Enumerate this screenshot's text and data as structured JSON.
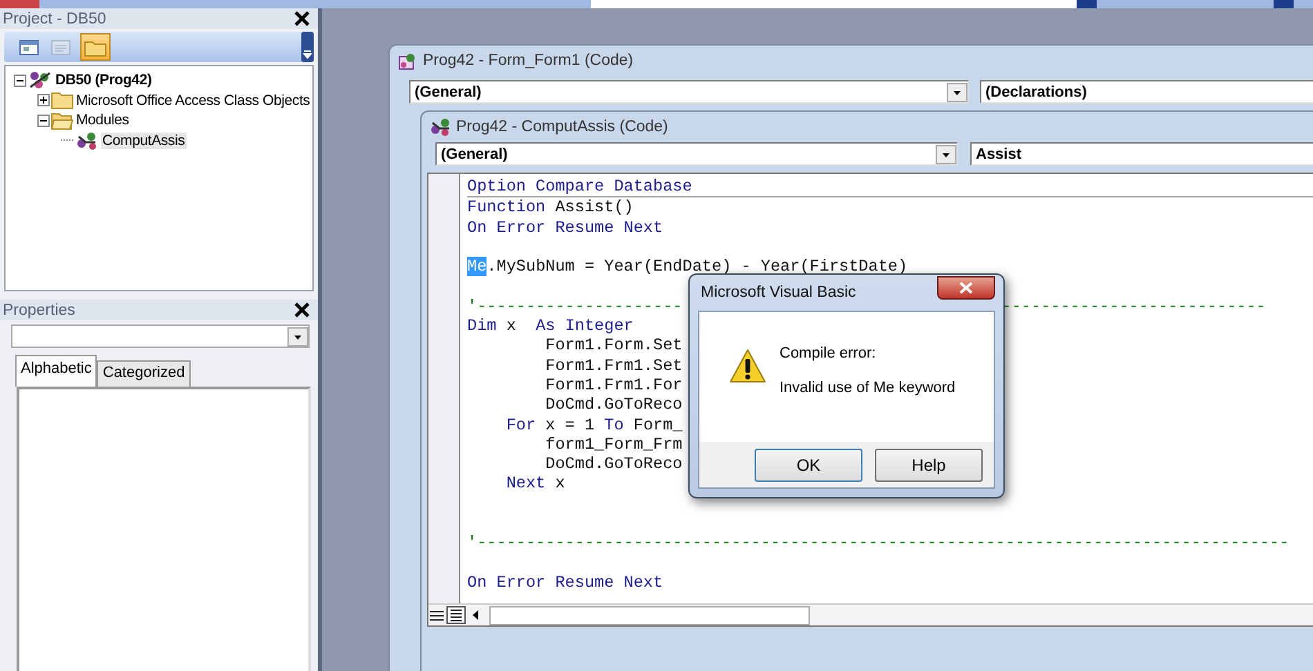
{
  "project_pane": {
    "title": "Project - DB50",
    "toolbar_buttons": [
      {
        "kind": "form",
        "selected": false,
        "disabled": false
      },
      {
        "kind": "list",
        "selected": false,
        "disabled": true
      },
      {
        "kind": "folder",
        "selected": true,
        "disabled": false
      }
    ],
    "tree": [
      {
        "label": "DB50 (Prog42)",
        "kind": "project",
        "expanded": true,
        "selected": false,
        "children": [
          {
            "label": "Microsoft Office Access Class Objects",
            "kind": "folder",
            "expanded": false,
            "selected": false
          },
          {
            "label": "Modules",
            "kind": "folder",
            "expanded": true,
            "selected": false,
            "children": [
              {
                "label": "ComputAssis",
                "kind": "module",
                "selected": true
              }
            ]
          }
        ]
      }
    ]
  },
  "properties_pane": {
    "title": "Properties",
    "tabs": [
      {
        "label": "Alphabetic",
        "selected": true
      },
      {
        "label": "Categorized",
        "selected": false
      }
    ]
  },
  "form_window": {
    "title": "Prog42 - Form_Form1 (Code)",
    "object_combo": "(General)",
    "procedure_combo": "(Declarations)"
  },
  "module_window": {
    "title": "Prog42 - ComputAssis (Code)",
    "object_combo": "(General)",
    "procedure_combo": "Assist",
    "code_lines": [
      {
        "separator": true,
        "segments": [
          {
            "text": "Option Compare Database",
            "kind": "keyword"
          }
        ]
      },
      {
        "segments": [
          {
            "text": "Function",
            "kind": "keyword"
          },
          {
            "text": " Assist()",
            "kind": "plain"
          }
        ]
      },
      {
        "segments": [
          {
            "text": "On Error Resume Next",
            "kind": "keyword"
          }
        ]
      },
      {
        "blank_before": true,
        "segments": [
          {
            "text": "Me",
            "kind": "selected"
          },
          {
            "text": ".MySubNum = Year(EndDate) - Year(FirstDate)",
            "kind": "plain"
          }
        ]
      },
      {
        "blank_before": true,
        "segments": [
          {
            "text": "'---------------------",
            "kind": "comment"
          }
        ],
        "tail": {
          "text": "---------------------------",
          "kind": "comment"
        }
      },
      {
        "segments": [
          {
            "text": "Dim",
            "kind": "keyword"
          },
          {
            "text": " x  ",
            "kind": "plain"
          },
          {
            "text": "As Integer",
            "kind": "keyword"
          }
        ]
      },
      {
        "segments": [
          {
            "text": "        Form1.Form.Set",
            "kind": "plain"
          }
        ]
      },
      {
        "segments": [
          {
            "text": "        Form1.Frm1.Set",
            "kind": "plain"
          }
        ]
      },
      {
        "segments": [
          {
            "text": "        Form1.Frm1.For",
            "kind": "plain"
          }
        ]
      },
      {
        "segments": [
          {
            "text": "        DoCmd.GoToReco",
            "kind": "plain"
          }
        ]
      },
      {
        "segments": [
          {
            "text": "    For",
            "kind": "keyword"
          },
          {
            "text": " x = 1 ",
            "kind": "plain"
          },
          {
            "text": "To",
            "kind": "keyword"
          },
          {
            "text": " Form_",
            "kind": "plain"
          }
        ]
      },
      {
        "segments": [
          {
            "text": "        form1_Form_Frm",
            "kind": "plain"
          }
        ]
      },
      {
        "segments": [
          {
            "text": "        DoCmd.GoToReco",
            "kind": "plain"
          }
        ]
      },
      {
        "blank_after": true,
        "segments": [
          {
            "text": "    Next",
            "kind": "keyword"
          },
          {
            "text": " x",
            "kind": "plain"
          }
        ]
      },
      {
        "blank_before": true,
        "segments": [
          {
            "text": "'-----------------------------------------------------------------------------------",
            "kind": "comment"
          }
        ]
      },
      {
        "blank_before": true,
        "segments": [
          {
            "text": "On Error Resume Next",
            "kind": "keyword"
          }
        ]
      }
    ]
  },
  "dialog": {
    "title": "Microsoft Visual Basic",
    "heading": "Compile error:",
    "message": "Invalid use of Me keyword",
    "buttons": [
      "OK",
      "Help"
    ]
  }
}
